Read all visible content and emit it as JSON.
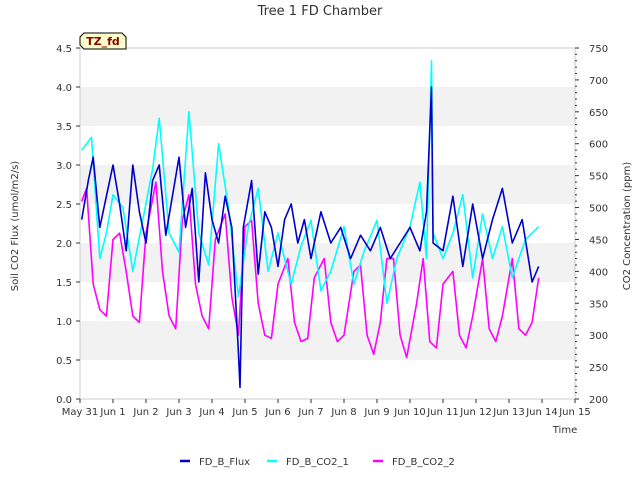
{
  "chart_data": {
    "type": "line",
    "title": "Tree 1 FD Chamber",
    "xlabel": "Time",
    "ylabel_left": "Soil CO2 Flux (umol/m2/s)",
    "ylabel_right": "CO2 Concentration (ppm)",
    "ylim_left": [
      0,
      4.5
    ],
    "ylim_right": [
      200,
      750
    ],
    "x_range_days": [
      0,
      15
    ],
    "x_tick_labels": [
      "May 31",
      "Jun 1",
      "Jun 2",
      "Jun 3",
      "Jun 4",
      "Jun 5",
      "Jun 6",
      "Jun 7",
      "Jun 8",
      "Jun 9",
      "Jun 10",
      "Jun 11",
      "Jun 12",
      "Jun 13",
      "Jun 14",
      "Jun 15"
    ],
    "y_left_ticks": [
      "0.0",
      "0.5",
      "1.0",
      "1.5",
      "2.0",
      "2.5",
      "3.0",
      "3.5",
      "4.0",
      "4.5"
    ],
    "y_right_ticks": [
      "200",
      "250",
      "300",
      "350",
      "400",
      "450",
      "500",
      "550",
      "600",
      "650",
      "700",
      "750"
    ],
    "grid": "horizontal alternating bands",
    "legend_placement": "bottom-center",
    "badge": "TZ_fd",
    "series": [
      {
        "name": "FD_B_Flux",
        "axis": "left",
        "color": "#0000cc",
        "points": [
          [
            0.05,
            2.3
          ],
          [
            0.25,
            2.8
          ],
          [
            0.4,
            3.1
          ],
          [
            0.6,
            2.2
          ],
          [
            0.8,
            2.6
          ],
          [
            1.0,
            3.0
          ],
          [
            1.2,
            2.5
          ],
          [
            1.4,
            1.9
          ],
          [
            1.6,
            3.0
          ],
          [
            1.8,
            2.4
          ],
          [
            2.0,
            2.0
          ],
          [
            2.2,
            2.8
          ],
          [
            2.4,
            3.0
          ],
          [
            2.6,
            2.1
          ],
          [
            2.8,
            2.6
          ],
          [
            3.0,
            3.1
          ],
          [
            3.2,
            2.2
          ],
          [
            3.4,
            2.7
          ],
          [
            3.6,
            1.5
          ],
          [
            3.8,
            2.9
          ],
          [
            4.0,
            2.3
          ],
          [
            4.2,
            2.0
          ],
          [
            4.4,
            2.6
          ],
          [
            4.6,
            2.2
          ],
          [
            4.8,
            0.6
          ],
          [
            4.85,
            0.15
          ],
          [
            4.95,
            2.2
          ],
          [
            5.2,
            2.8
          ],
          [
            5.4,
            1.6
          ],
          [
            5.6,
            2.4
          ],
          [
            5.8,
            2.2
          ],
          [
            6.0,
            1.7
          ],
          [
            6.2,
            2.3
          ],
          [
            6.4,
            2.5
          ],
          [
            6.6,
            2.0
          ],
          [
            6.8,
            2.3
          ],
          [
            7.0,
            1.8
          ],
          [
            7.3,
            2.4
          ],
          [
            7.6,
            2.0
          ],
          [
            7.9,
            2.2
          ],
          [
            8.2,
            1.8
          ],
          [
            8.5,
            2.1
          ],
          [
            8.8,
            1.9
          ],
          [
            9.1,
            2.2
          ],
          [
            9.4,
            1.8
          ],
          [
            9.7,
            2.0
          ],
          [
            10.0,
            2.2
          ],
          [
            10.3,
            1.9
          ],
          [
            10.5,
            2.4
          ],
          [
            10.65,
            4.0
          ],
          [
            10.7,
            2.0
          ],
          [
            11.0,
            1.9
          ],
          [
            11.3,
            2.6
          ],
          [
            11.6,
            1.7
          ],
          [
            11.9,
            2.5
          ],
          [
            12.2,
            1.8
          ],
          [
            12.5,
            2.3
          ],
          [
            12.8,
            2.7
          ],
          [
            13.1,
            2.0
          ],
          [
            13.4,
            2.3
          ],
          [
            13.7,
            1.5
          ],
          [
            13.9,
            1.7
          ]
        ]
      },
      {
        "name": "FD_B_CO2_1",
        "axis": "right",
        "color": "#00ffff",
        "points": [
          [
            0.05,
            590
          ],
          [
            0.2,
            600
          ],
          [
            0.35,
            610
          ],
          [
            0.6,
            420
          ],
          [
            0.8,
            460
          ],
          [
            1.0,
            520
          ],
          [
            1.3,
            500
          ],
          [
            1.6,
            400
          ],
          [
            1.9,
            480
          ],
          [
            2.2,
            560
          ],
          [
            2.4,
            640
          ],
          [
            2.7,
            460
          ],
          [
            3.0,
            430
          ],
          [
            3.3,
            650
          ],
          [
            3.6,
            460
          ],
          [
            3.9,
            410
          ],
          [
            4.2,
            600
          ],
          [
            4.5,
            500
          ],
          [
            4.8,
            360
          ],
          [
            5.1,
            470
          ],
          [
            5.4,
            530
          ],
          [
            5.7,
            400
          ],
          [
            6.0,
            460
          ],
          [
            6.4,
            380
          ],
          [
            6.7,
            440
          ],
          [
            7.0,
            480
          ],
          [
            7.3,
            370
          ],
          [
            7.6,
            400
          ],
          [
            8.0,
            470
          ],
          [
            8.3,
            380
          ],
          [
            8.6,
            430
          ],
          [
            9.0,
            480
          ],
          [
            9.3,
            350
          ],
          [
            9.6,
            420
          ],
          [
            10.0,
            470
          ],
          [
            10.3,
            540
          ],
          [
            10.5,
            420
          ],
          [
            10.65,
            730
          ],
          [
            10.7,
            460
          ],
          [
            11.0,
            420
          ],
          [
            11.3,
            460
          ],
          [
            11.6,
            520
          ],
          [
            11.9,
            390
          ],
          [
            12.2,
            490
          ],
          [
            12.5,
            420
          ],
          [
            12.8,
            470
          ],
          [
            13.1,
            390
          ],
          [
            13.5,
            450
          ],
          [
            13.9,
            470
          ]
        ]
      },
      {
        "name": "FD_B_CO2_2",
        "axis": "right",
        "color": "#ff00ff",
        "points": [
          [
            0.05,
            510
          ],
          [
            0.2,
            530
          ],
          [
            0.4,
            380
          ],
          [
            0.6,
            340
          ],
          [
            0.8,
            330
          ],
          [
            1.0,
            450
          ],
          [
            1.2,
            460
          ],
          [
            1.4,
            400
          ],
          [
            1.6,
            330
          ],
          [
            1.8,
            320
          ],
          [
            2.0,
            460
          ],
          [
            2.3,
            540
          ],
          [
            2.5,
            400
          ],
          [
            2.7,
            330
          ],
          [
            2.9,
            310
          ],
          [
            3.1,
            480
          ],
          [
            3.3,
            520
          ],
          [
            3.5,
            380
          ],
          [
            3.7,
            330
          ],
          [
            3.9,
            310
          ],
          [
            4.1,
            450
          ],
          [
            4.4,
            490
          ],
          [
            4.6,
            360
          ],
          [
            4.8,
            300
          ],
          [
            5.0,
            470
          ],
          [
            5.2,
            480
          ],
          [
            5.4,
            350
          ],
          [
            5.6,
            300
          ],
          [
            5.8,
            295
          ],
          [
            6.0,
            380
          ],
          [
            6.3,
            420
          ],
          [
            6.5,
            320
          ],
          [
            6.7,
            290
          ],
          [
            6.9,
            295
          ],
          [
            7.1,
            390
          ],
          [
            7.4,
            420
          ],
          [
            7.6,
            320
          ],
          [
            7.8,
            290
          ],
          [
            8.0,
            300
          ],
          [
            8.3,
            400
          ],
          [
            8.5,
            410
          ],
          [
            8.7,
            300
          ],
          [
            8.9,
            270
          ],
          [
            9.1,
            320
          ],
          [
            9.3,
            420
          ],
          [
            9.5,
            420
          ],
          [
            9.7,
            300
          ],
          [
            9.9,
            265
          ],
          [
            10.2,
            350
          ],
          [
            10.4,
            420
          ],
          [
            10.6,
            290
          ],
          [
            10.8,
            280
          ],
          [
            11.0,
            380
          ],
          [
            11.3,
            400
          ],
          [
            11.5,
            300
          ],
          [
            11.7,
            280
          ],
          [
            11.9,
            330
          ],
          [
            12.2,
            420
          ],
          [
            12.4,
            310
          ],
          [
            12.6,
            290
          ],
          [
            12.8,
            330
          ],
          [
            13.1,
            420
          ],
          [
            13.3,
            310
          ],
          [
            13.5,
            300
          ],
          [
            13.7,
            320
          ],
          [
            13.9,
            390
          ]
        ]
      }
    ]
  }
}
